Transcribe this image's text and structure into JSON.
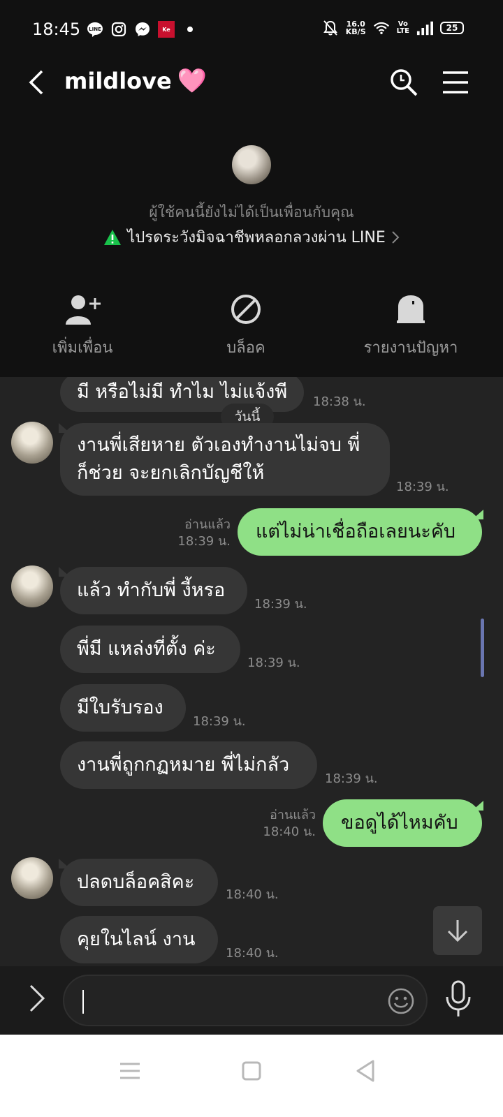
{
  "status_bar": {
    "time": "18:45",
    "speed_value": "16.0",
    "speed_unit": "KB/S",
    "volte_top": "Vo",
    "volte_bottom": "LTE",
    "battery": "25",
    "icons": [
      "line-app-icon",
      "instagram-icon",
      "messenger-icon",
      "kerry-app-icon",
      "dot-icon",
      "mute-bell-icon",
      "wifi-icon",
      "signal-icon",
      "battery-icon"
    ]
  },
  "header": {
    "title": "mildlove",
    "title_emoji": "🩷",
    "not_friend_text": "ผู้ใช้คนนี้ยังไม่ได้เป็นเพื่อนกับคุณ",
    "warning_text": "ไปรดระวังมิจฉาชีพหลอกลวงผ่าน LINE",
    "actions": [
      {
        "label": "เพิ่มเพื่อน",
        "icon": "add-friend-icon"
      },
      {
        "label": "บล็อค",
        "icon": "block-icon"
      },
      {
        "label": "รายงานปัญหา",
        "icon": "report-icon"
      }
    ]
  },
  "chat": {
    "date_chip": "วันนี้",
    "messages": [
      {
        "from": "them",
        "text": "มี หรือไม่มี ทำไม ไม่แจ้งพี",
        "time": "18:38 น."
      },
      {
        "from": "them",
        "text": "งานพี่เสียหาย ตัวเองทำงานไม่จบ พี่",
        "text2": "ก็ช่วย จะยกเลิกบัญชีให้",
        "time": "18:39 น."
      },
      {
        "from": "me",
        "text": "แต่ไม่น่าเชื่อถือเลยนะคับ",
        "read": "อ่านแล้ว",
        "time": "18:39 น."
      },
      {
        "from": "them",
        "text": "แล้ว ทำกับพี่ งี้หรอ",
        "time": "18:39 น."
      },
      {
        "from": "them",
        "text": "พี่มี แหล่งที่ตั้ง ค่ะ",
        "time": "18:39 น."
      },
      {
        "from": "them",
        "text": "มีใบรับรอง",
        "time": "18:39 น."
      },
      {
        "from": "them",
        "text": "งานพี่ถูกกฏหมาย พี่ไม่กลัว",
        "time": "18:39 น."
      },
      {
        "from": "me",
        "text": "ขอดูได้ไหมคับ",
        "read": "อ่านแล้ว",
        "time": "18:40 น."
      },
      {
        "from": "them",
        "text": "ปลดบล็อคสิคะ",
        "time": "18:40 น."
      },
      {
        "from": "them",
        "text": "คุยในไลน์ งาน",
        "time": "18:40 น."
      }
    ]
  },
  "input": {
    "value": ""
  },
  "colors": {
    "outgoing_bubble": "#8fe086",
    "incoming_bubble": "#363636",
    "header_bg": "#111111",
    "chat_bg": "#232323"
  }
}
